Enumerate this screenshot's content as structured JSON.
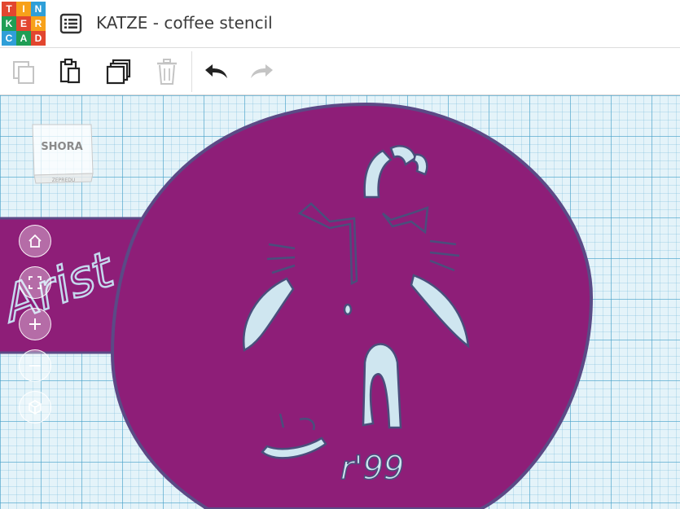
{
  "app": {
    "logo_letters": [
      "T",
      "I",
      "N",
      "K",
      "E",
      "R",
      "C",
      "A",
      "D"
    ],
    "logo_colors": [
      "#e2462f",
      "#f7a11a",
      "#2f9fd8",
      "#1f9e55",
      "#e2462f",
      "#f7a11a",
      "#2f9fd8",
      "#1f9e55",
      "#e2462f"
    ],
    "title": "KATZE - coffee stencil"
  },
  "toolbar": {
    "buttons": [
      {
        "name": "copy",
        "icon": "copy-icon",
        "enabled": false
      },
      {
        "name": "paste",
        "icon": "paste-icon",
        "enabled": true
      },
      {
        "name": "duplicate",
        "icon": "duplicate-icon",
        "enabled": true
      },
      {
        "name": "delete",
        "icon": "trash-icon",
        "enabled": false
      },
      {
        "name": "undo",
        "icon": "undo-icon",
        "enabled": true
      },
      {
        "name": "redo",
        "icon": "redo-icon",
        "enabled": false
      }
    ]
  },
  "viewcube": {
    "face_label": "SHORA",
    "side_label": "ZEPREDU"
  },
  "canvas": {
    "stencil_text": "Arist",
    "signature_text": "r'99",
    "shape_color": "#8e1e78",
    "edge_color": "#5b4a86",
    "grid_color": "#e4f3f9"
  },
  "view_controls": [
    {
      "name": "home-view",
      "icon": "home-icon"
    },
    {
      "name": "fit-view",
      "icon": "fit-icon"
    },
    {
      "name": "zoom-in",
      "icon": "plus-icon"
    },
    {
      "name": "zoom-out",
      "icon": "minus-icon"
    },
    {
      "name": "ortho-view",
      "icon": "cube-icon"
    }
  ]
}
